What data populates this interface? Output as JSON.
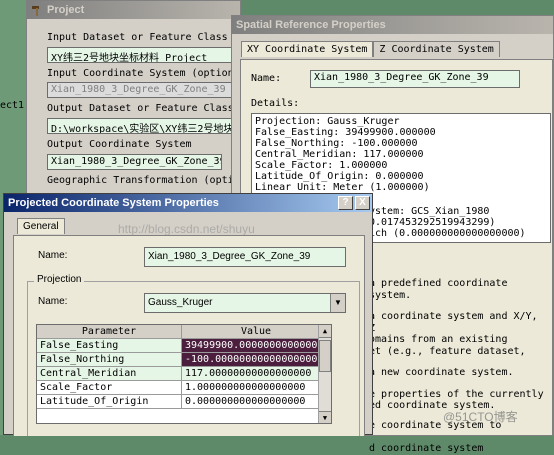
{
  "project_window": {
    "title": "Project",
    "left_label": "ect1",
    "input_dataset_label": "Input Dataset or Feature Class",
    "input_dataset_value": "XY纬三2号地块坐标材料_Project",
    "input_cs_label": "Input Coordinate System (optional",
    "input_cs_value": "Xian_1980_3_Degree_GK_Zone_39",
    "output_dataset_label": "Output Dataset or Feature Class",
    "output_dataset_value": "D:\\workspace\\实验区\\XY纬三2号地块",
    "output_cs_label": "Output Coordinate System",
    "output_cs_value": "Xian_1980_3_Degree_GK_Zone_39",
    "geo_transform_label": "Geographic Transformation (option"
  },
  "srp_window": {
    "title": "Spatial Reference Properties",
    "tabs": [
      "XY Coordinate System",
      "Z Coordinate System"
    ],
    "name_label": "Name:",
    "name_value": "Xian_1980_3_Degree_GK_Zone_39",
    "details_label": "Details:",
    "details_lines": [
      "Projection: Gauss_Kruger",
      "False_Easting: 39499900.000000",
      "False_Northing: -100.000000",
      "Central_Meridian: 117.000000",
      "Scale_Factor: 1.000000",
      "Latitude_Of_Origin: 0.000000",
      "Linear Unit: Meter (1.000000)"
    ],
    "details_tail_lines": [
      "ystem: GCS_Xian_1980",
      "0.017453292519943299)",
      "ich (0.000000000000000000)"
    ],
    "help_lines": [
      "a predefined coordinate system.",
      "a coordinate system and X/Y, Z",
      "omains from an existing",
      "et (e.g., feature dataset,",
      "a new coordinate system.",
      "e properties of the currently",
      "ed coordinate system.",
      "e coordinate system to",
      "d coordinate system"
    ]
  },
  "pcs_dialog": {
    "title": "Projected Coordinate System Properties",
    "help_button": "?",
    "close_button": "X",
    "tab": "General",
    "name_label": "Name:",
    "name_value": "Xian_1980_3_Degree_GK_Zone_39",
    "projection_group": "Projection",
    "proj_name_label": "Name:",
    "proj_name_value": "Gauss_Kruger",
    "grid_headers": [
      "Parameter",
      "Value"
    ],
    "grid_rows": [
      {
        "param": "False_Easting",
        "value": "39499900.0000000000000000"
      },
      {
        "param": "False_Northing",
        "value": "-100.000000000000000000"
      },
      {
        "param": "Central_Meridian",
        "value": "117.00000000000000000"
      },
      {
        "param": "Scale_Factor",
        "value": "1.000000000000000000"
      },
      {
        "param": "Latitude_Of_Origin",
        "value": "0.000000000000000000"
      }
    ]
  },
  "watermarks": {
    "blog_url": "http://blog.csdn.net/shuyu",
    "site_mark": "@51CTO博客"
  }
}
